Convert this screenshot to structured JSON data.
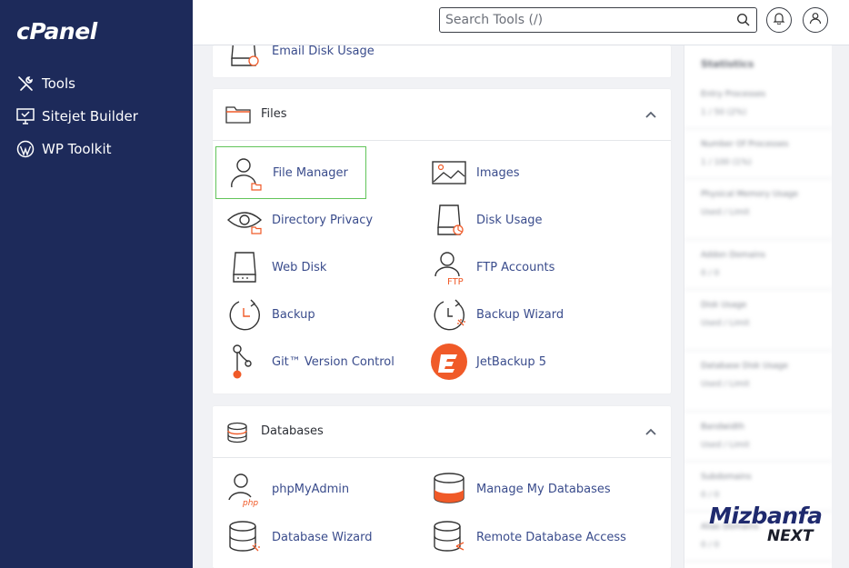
{
  "sidebar": {
    "logo": "cPanel",
    "items": [
      {
        "label": "Tools",
        "icon": "tools-icon"
      },
      {
        "label": "Sitejet Builder",
        "icon": "sitejet-icon"
      },
      {
        "label": "WP Toolkit",
        "icon": "wordpress-icon"
      }
    ]
  },
  "header": {
    "search_placeholder": "Search Tools (/)"
  },
  "top_partial": {
    "label": "Email Disk Usage"
  },
  "files": {
    "title": "Files",
    "tools": [
      {
        "label": "File Manager",
        "icon": "file-manager-icon"
      },
      {
        "label": "Images",
        "icon": "images-icon"
      },
      {
        "label": "Directory Privacy",
        "icon": "directory-privacy-icon"
      },
      {
        "label": "Disk Usage",
        "icon": "disk-usage-icon"
      },
      {
        "label": "Web Disk",
        "icon": "web-disk-icon"
      },
      {
        "label": "FTP Accounts",
        "icon": "ftp-accounts-icon"
      },
      {
        "label": "Backup",
        "icon": "backup-icon"
      },
      {
        "label": "Backup Wizard",
        "icon": "backup-wizard-icon"
      },
      {
        "label": "Git™ Version Control",
        "icon": "git-icon"
      },
      {
        "label": "JetBackup 5",
        "icon": "jetbackup-icon"
      }
    ]
  },
  "databases": {
    "title": "Databases",
    "tools": [
      {
        "label": "phpMyAdmin",
        "icon": "phpmyadmin-icon"
      },
      {
        "label": "Manage My Databases",
        "icon": "manage-databases-icon"
      },
      {
        "label": "Database Wizard",
        "icon": "database-wizard-icon"
      },
      {
        "label": "Remote Database Access",
        "icon": "remote-database-icon"
      }
    ]
  },
  "stats": {
    "title": "Statistics",
    "rows": [
      {
        "label": "Entry Processes",
        "value": "1 / 50 (2%)"
      },
      {
        "label": "Number Of Processes",
        "value": "1 / 100 (1%)"
      },
      {
        "label": "Physical Memory Usage",
        "value": "Used / Limit"
      },
      {
        "label": "Addon Domains",
        "value": "0 / 0"
      },
      {
        "label": "Disk Usage",
        "value": "Used / Limit"
      },
      {
        "label": "Database Disk Usage",
        "value": "Used / Limit"
      },
      {
        "label": "Bandwidth",
        "value": "Used / Limit"
      },
      {
        "label": "Subdomains",
        "value": "0 / 0"
      },
      {
        "label": "Alias Domains",
        "value": "0 / 0"
      }
    ]
  },
  "watermark": {
    "line1": "Mizbanfa",
    "line2": "NEXT"
  },
  "colors": {
    "sidebar_bg": "#1d2a5a",
    "link": "#3a4c8c",
    "accent_orange": "#f05a28",
    "active_border": "#62c45a"
  }
}
